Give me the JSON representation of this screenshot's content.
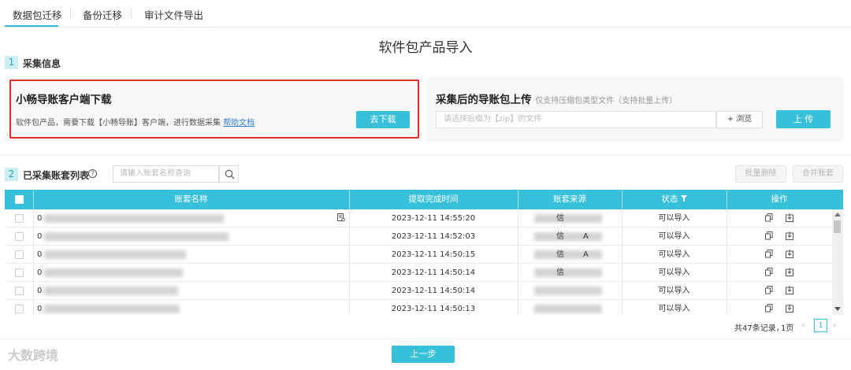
{
  "tabs": [
    {
      "label": "数据包迁移"
    },
    {
      "label": "备份迁移"
    },
    {
      "label": "审计文件导出"
    }
  ],
  "page_title": "软件包产品导入",
  "step1": {
    "number": "1",
    "label": "采集信息"
  },
  "download_panel": {
    "title": "小畅导账客户端下载",
    "description": "软件包产品，需要下载【小畅导账】客户端，进行数据采集",
    "help_link": "帮助文档",
    "button": "去下载"
  },
  "upload_panel": {
    "title": "采集后的导账包上传",
    "subtitle": "仅支持压缩包类型文件（支持批量上传）",
    "placeholder": "请选择后缀为【zip】的文件",
    "browse": "+ 浏览",
    "button": "上 传"
  },
  "step2": {
    "number": "2",
    "label": "已采集账套列表",
    "help": "?"
  },
  "search": {
    "placeholder": "请输入账套名称查询"
  },
  "actions": {
    "batch_delete": "批量删除",
    "merge": "合并账套"
  },
  "table": {
    "columns": [
      "账套名称",
      "提取完成时间",
      "账套来源",
      "状态",
      "操作"
    ],
    "rows": [
      {
        "name_prefix": "0",
        "time": "2023-12-11 14:55:20",
        "src_a": "信",
        "src_b": "",
        "status": "可以导入"
      },
      {
        "name_prefix": "0",
        "time": "2023-12-11 14:52:03",
        "src_a": "信",
        "src_b": "A",
        "status": "可以导入"
      },
      {
        "name_prefix": "0",
        "time": "2023-12-11 14:50:15",
        "src_a": "信",
        "src_b": "A",
        "status": "可以导入"
      },
      {
        "name_prefix": "0",
        "time": "2023-12-11 14:50:14",
        "src_a": "信",
        "src_b": "",
        "status": "可以导入"
      },
      {
        "name_prefix": "0",
        "time": "2023-12-11 14:50:14",
        "src_a": "",
        "src_b": "",
        "status": "可以导入"
      },
      {
        "name_prefix": "0",
        "time": "2023-12-11 14:50:13",
        "src_a": "",
        "src_b": "",
        "status": "可以导入"
      }
    ]
  },
  "pagination": {
    "total": "共47条记录，",
    "pages": "1页",
    "current": "1"
  },
  "footer": {
    "prev_button": "上一步"
  },
  "watermark": "大数跨境",
  "colors": {
    "accent": "#36c0d9",
    "highlight": "#e0312f",
    "link": "#2f7fd6"
  }
}
